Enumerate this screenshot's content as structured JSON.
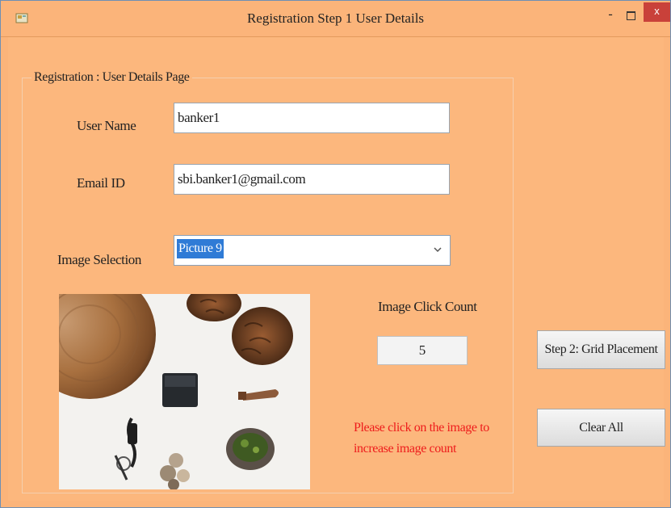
{
  "window": {
    "title": "Registration Step 1 User Details",
    "minimize_label": "-",
    "close_label": "x"
  },
  "form": {
    "group_title": "Registration : User Details Page",
    "username_label": "User Name",
    "username_value": "banker1",
    "email_label": "Email ID",
    "email_value": "sbi.banker1@gmail.com",
    "image_label": "Image Selection",
    "image_selected": "Picture 9",
    "click_count_label": "Image Click Count",
    "click_count_value": "5",
    "hint_line1": "Please click on the image to",
    "hint_line2": "increase image count"
  },
  "buttons": {
    "grid_placement": "Step 2: Grid Placement",
    "clear_all": "Clear All"
  },
  "colors": {
    "background": "#fbb47a",
    "hint_text": "#ee1c1c",
    "close_button": "#c9413a",
    "selection_highlight": "#2f7bd6"
  },
  "icons": {
    "app": "app-icon",
    "dropdown": "chevron-down-icon"
  }
}
